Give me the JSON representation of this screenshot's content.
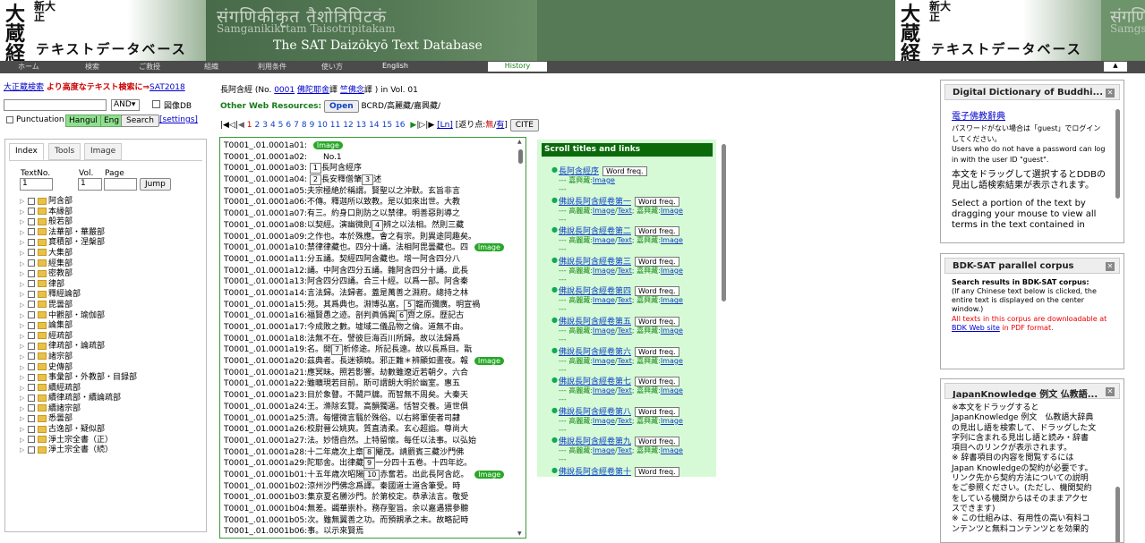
{
  "header": {
    "logo_small": "新大正",
    "logo_big1": "大",
    "logo_big2": "蔵",
    "logo_big3": "経",
    "logo_text": "テキストデータベース",
    "sanskrit": "संगणिकीकृत तैशोत्रिपिटकं",
    "romanized": "Samganikikrtam Taisotripitakam",
    "english": "The SAT Daizōkyō Text Database",
    "sanskrit_cut": "संगणि",
    "romanized_cut": "Samgs"
  },
  "nav": {
    "items": [
      "ホーム",
      "検索",
      "ご救授",
      "組織",
      "利用条件",
      "使い方",
      "English"
    ],
    "history": "History",
    "up": "▲"
  },
  "left": {
    "link1": "大正蔵検索",
    "link1_suffix": "より高度なテキスト検索に⇒",
    "link2": "SAT2018",
    "and_value": "AND",
    "image_checkbox": "図像DB",
    "punctuation": "Punctuation",
    "hangul": "Hangul",
    "eng": "Eng",
    "search": "Search",
    "settings": "[settings]",
    "tabs": [
      "Index",
      "Tools",
      "Image"
    ],
    "textno_label": "TextNo.",
    "vol_label": "Vol.",
    "page_label": "Page",
    "textno_value": "1",
    "vol_value": "1",
    "jump": "Jump",
    "tree": [
      "阿含部",
      "本縁部",
      "般若部",
      "法華部・華嚴部",
      "寶積部・涅槃部",
      "大集部",
      "經集部",
      "密教部",
      "律部",
      "釋經論部",
      "毘曇部",
      "中觀部・瑜伽部",
      "論集部",
      "經疏部",
      "律疏部・論疏部",
      "諸宗部",
      "史傳部",
      "事彙部・外教部・目録部",
      "續經疏部",
      "續律疏部・續論疏部",
      "續諸宗部",
      "悉曇部",
      "古逸部・疑似部",
      "淨土宗全書（正）",
      "淨土宗全書（続）"
    ]
  },
  "mid": {
    "title_pre": "長阿含經 (No.",
    "no": "0001",
    "tr1": "佛陀耶舍",
    "tr_mid": "譯",
    "tr2": "竺佛念",
    "title_post": "譯 ) in Vol. 01",
    "web_label": "Other Web Resources:",
    "open": "Open",
    "bcrd": "BCRD/高麗藏/嘉興藏/",
    "pages": [
      "1",
      "2",
      "3",
      "4",
      "5",
      "6",
      "7",
      "8",
      "9",
      "10",
      "11",
      "12",
      "13",
      "14",
      "15",
      "16"
    ],
    "ln": "[Ln]",
    "kaeri_label": "[返り点:",
    "kaeri_none": "無",
    "kaeri_has": "有",
    "kaeri_close": "]",
    "cite": "CITE"
  },
  "lines": [
    {
      "id": "T0001_.01.0001a01:",
      "text": "",
      "img": "Image",
      "box": ""
    },
    {
      "id": "T0001_.01.0001a02:",
      "text": "　　No.1",
      "img": "",
      "box": ""
    },
    {
      "id": "T0001_.01.0001a03:",
      "text": "長阿含經序",
      "img": "",
      "box": "1"
    },
    {
      "id": "T0001_.01.0001a04:",
      "text": "長安釋僧肇",
      "img": "",
      "box": "2",
      "box2": "3",
      "tail": "述"
    },
    {
      "id": "T0001_.01.0001a05:",
      "text": "夫宗極絶於稱謂。賢聖以之沖默。玄旨非言",
      "img": "",
      "box": ""
    },
    {
      "id": "T0001_.01.0001a06:",
      "text": "不傳。釋迦所以致教。是以如來出世。大教",
      "img": "",
      "box": ""
    },
    {
      "id": "T0001_.01.0001a07:",
      "text": "有三。約身口則防之以禁律。明善惡則導之",
      "img": "",
      "box": ""
    },
    {
      "id": "T0001_.01.0001a08:",
      "text": "以契經。演幽微則",
      "img": "",
      "box": "4",
      "tail": "辨之以法相。然則三藏"
    },
    {
      "id": "T0001_.01.0001a09:",
      "text": "之作也。本於殊應。會之有宗。則異途同趣矣。",
      "img": "",
      "box": ""
    },
    {
      "id": "T0001_.01.0001a10:",
      "text": "禁律律藏也。四分十誦。法相阿毘曇藏也。四",
      "img": "Image",
      "box": ""
    },
    {
      "id": "T0001_.01.0001a11:",
      "text": "分五誦。契經四阿含藏也。增一阿含四分八",
      "img": "",
      "box": ""
    },
    {
      "id": "T0001_.01.0001a12:",
      "text": "誦。中阿含四分五誦。雜阿含四分十誦。此長",
      "img": "",
      "box": ""
    },
    {
      "id": "T0001_.01.0001a13:",
      "text": "阿含四分四誦。合三十經。以爲一部。阿含秦",
      "img": "",
      "box": ""
    },
    {
      "id": "T0001_.01.0001a14:",
      "text": "言法歸。法歸者。蓋是萬善之淵府。總持之林",
      "img": "",
      "box": ""
    },
    {
      "id": "T0001_.01.0001a15:",
      "text": "苑。其爲典也。淵博弘富。",
      "img": "",
      "box": "5",
      "tail": "韞而彌廣。明宣禍"
    },
    {
      "id": "T0001_.01.0001a16:",
      "text": "福賢愚之迹。剖判眞僞異",
      "img": "",
      "box": "6",
      "tail": "齊之原。歴記古"
    },
    {
      "id": "T0001_.01.0001a17:",
      "text": "今成敗之數。墟域二儀品物之倫。道無不由。",
      "img": "",
      "box": ""
    },
    {
      "id": "T0001_.01.0001a18:",
      "text": "法無不在。譬彼巨海百川所歸。故以法歸爲",
      "img": "",
      "box": ""
    },
    {
      "id": "T0001_.01.0001a19:",
      "text": "名。開",
      "img": "",
      "box": "7",
      "tail": "析修途。所記長遠。故以長爲目。翫"
    },
    {
      "id": "T0001_.01.0001a20:",
      "text": "茲典者。長迷頓曉。邪正難＊辨顯如晝夜。報",
      "img": "Image",
      "box": ""
    },
    {
      "id": "T0001_.01.0001a21:",
      "text": "應冥昧。照若影響。劫數雖遼近若朝夕。六合",
      "img": "",
      "box": ""
    },
    {
      "id": "T0001_.01.0001a22:",
      "text": "雖曠現若目前。斯可謂朗大明於幽室。惠五",
      "img": "",
      "box": ""
    },
    {
      "id": "T0001_.01.0001a23:",
      "text": "目於象瞽。不闚戸牖。而智無不周矣。大秦天",
      "img": "",
      "box": ""
    },
    {
      "id": "T0001_.01.0001a24:",
      "text": "王。滌除玄覽。高韻獨邁。恬智交養。道世俱",
      "img": "",
      "box": ""
    },
    {
      "id": "T0001_.01.0001a25:",
      "text": "濟。每懼微言翳於殊俗。以右將軍使者司隷",
      "img": "",
      "box": ""
    },
    {
      "id": "T0001_.01.0001a26:",
      "text": "校尉晉公姚爽。質直清柔。玄心超詣。尊尚大",
      "img": "",
      "box": ""
    },
    {
      "id": "T0001_.01.0001a27:",
      "text": "法。妙悟自然。上特留懷。每任以法事。以弘始",
      "img": "",
      "box": ""
    },
    {
      "id": "T0001_.01.0001a28:",
      "text": "十二年歳次上章",
      "img": "",
      "box": "8",
      "tail": "閹茂。請罽賓三藏沙門佛"
    },
    {
      "id": "T0001_.01.0001a29:",
      "text": "陀耶舍。出律藏",
      "img": "",
      "box": "9",
      "tail": "一分四十五卷。十四年訖。"
    },
    {
      "id": "T0001_.01.0001b01:",
      "text": "十五年歳次昭陽",
      "img": "Image",
      "box": "10",
      "tail": "赤奮若。出此長阿含訖。"
    },
    {
      "id": "T0001_.01.0001b02:",
      "text": "涼州沙門佛念爲譯。秦國道士道含筆受。時",
      "img": "",
      "box": ""
    },
    {
      "id": "T0001_.01.0001b03:",
      "text": "集京夏名勝沙門。於第校定。恭承法言。敬受",
      "img": "",
      "box": ""
    },
    {
      "id": "T0001_.01.0001b04:",
      "text": "無差。蠲華崇朴。務存聖旨。余以嘉遇猥參聽",
      "img": "",
      "box": ""
    },
    {
      "id": "T0001_.01.0001b05:",
      "text": "次。雖無翼善之功。而預親承之末。故略記時",
      "img": "",
      "box": ""
    },
    {
      "id": "T0001_.01.0001b06:",
      "text": "事。以示來賢焉",
      "img": "",
      "box": ""
    }
  ],
  "scroll": {
    "header": "Scroll titles and links",
    "items": [
      {
        "title": "長阿含經序",
        "wf": "Word freq.",
        "sub1": "嘉興藏:",
        "sub2": "Image",
        "text": ""
      },
      {
        "title": "佛說長阿含經卷第一",
        "wf": "Word freq.",
        "sub1": "高麗藏:",
        "sub2": "Image",
        "text": "Text"
      },
      {
        "title": "佛說長阿含經卷第二",
        "wf": "Word freq.",
        "sub1": "高麗藏:",
        "sub2": "Image",
        "text": "Text"
      },
      {
        "title": "佛說長阿含經卷第三",
        "wf": "Word freq.",
        "sub1": "高麗藏:",
        "sub2": "Image",
        "text": "Text"
      },
      {
        "title": "佛說長阿含經卷第四",
        "wf": "Word freq.",
        "sub1": "高麗藏:",
        "sub2": "Image",
        "text": "Text"
      },
      {
        "title": "佛說長阿含經卷第五",
        "wf": "Word freq.",
        "sub1": "高麗藏:",
        "sub2": "Image",
        "text": "Text"
      },
      {
        "title": "佛說長阿含經卷第六",
        "wf": "Word freq.",
        "sub1": "高麗藏:",
        "sub2": "Image",
        "text": "Text"
      },
      {
        "title": "佛說長阿含經卷第七",
        "wf": "Word freq.",
        "sub1": "高麗藏:",
        "sub2": "Image",
        "text": "Text"
      },
      {
        "title": "佛說長阿含經卷第八",
        "wf": "Word freq.",
        "sub1": "高麗藏:",
        "sub2": "Image",
        "text": "Text"
      },
      {
        "title": "佛說長阿含經卷第九",
        "wf": "Word freq.",
        "sub1": "高麗藏:",
        "sub2": "Image",
        "text": "Text"
      },
      {
        "title": "佛說長阿含經卷第十",
        "wf": "Word freq.",
        "sub1": "",
        "sub2": "",
        "text": ""
      }
    ],
    "kanji_label": "嘉興藏:"
  },
  "right": {
    "ddb_title": "Digital Dictionary of Buddhi...",
    "ddb_link": "電子佛教辭典",
    "ddb_lines": [
      "パスワードがない場合は「guest」でログインしてください。",
      "Users who do not have a password can log in with the user ID \"guest\".",
      "",
      "本文をドラッグして選択するとDDBの見出し語検索結果が表示されます。",
      "",
      "Select a portion of the text by dragging your mouse to view all terms in the text contained in"
    ],
    "bdk_title": "BDK-SAT parallel corpus",
    "bdk_bold": "Search results in BDK-SAT corpus:",
    "bdk_text": "(If any Chinese text below is clicked, the entire text is displayed on the center window.)",
    "bdk_red": "All texts in this corpus are downloadable at",
    "bdk_link": "BDK Web site",
    "bdk_red2": " in PDF format.",
    "jk_title": "JapanKnowledge 例文 仏教語...",
    "jk_lines": [
      "※本文をドラッグすると",
      "JapanKnowledge 例文　仏教語大辞典",
      "の見出し語を検索して、ドラッグした文",
      "字列に含まれる見出し語と読み・辞書",
      "項目へのリンクが表示されます。",
      "※ 辞書項目の内容を閲覧するには",
      "Japan Knowledgeの契約が必要です。",
      "リンク先から契約方法についての説明",
      "をご参照ください。(ただし、機関契約",
      "をしている機関からはそのままアクセ",
      "スできます)",
      "※ この仕組みは、有用性の高い有料コ",
      "ンテンツと無料コンテンツとを効果的"
    ]
  }
}
